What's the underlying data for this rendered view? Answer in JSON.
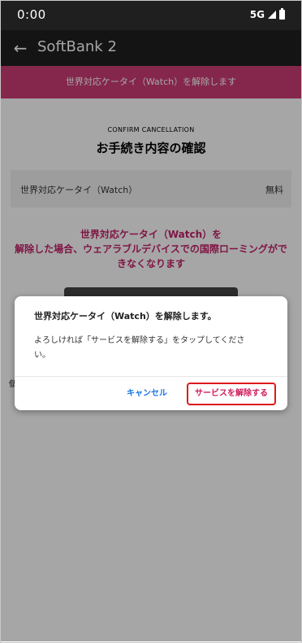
{
  "status_bar": {
    "time": "0:00",
    "network": "5G",
    "icons": [
      "signal-icon",
      "battery-icon"
    ]
  },
  "app_bar": {
    "back_icon": "arrow-left-icon",
    "title": "SoftBank 2"
  },
  "banner": {
    "text": "世界対応ケータイ（Watch）を解除します"
  },
  "page": {
    "caption": "CONFIRM CANCELLATION",
    "title": "お手続き内容の確認",
    "service": {
      "name": "世界対応ケータイ（Watch）",
      "price": "無料"
    },
    "warning_lines": [
      "世界対応ケータイ（Watch）を",
      "解除した場合、ウェアラブルデバイスでの国際ローミングがで",
      "きなくなります"
    ],
    "partial_hint": "個"
  },
  "dialog": {
    "title": "世界対応ケータイ（Watch）を解除します。",
    "message_lines": [
      "よろしければ「サービスを解除する」をタップしてくださ",
      "い。"
    ],
    "cancel_label": "キャンセル",
    "confirm_label": "サービスを解除する"
  },
  "colors": {
    "status_bar": "#1f1f1f",
    "banner": "#cc3d75",
    "warning_text": "#c4226a",
    "cancel_text": "#1a73e8",
    "confirm_text": "#d01c5c",
    "confirm_highlight_border": "#e01b1b"
  }
}
